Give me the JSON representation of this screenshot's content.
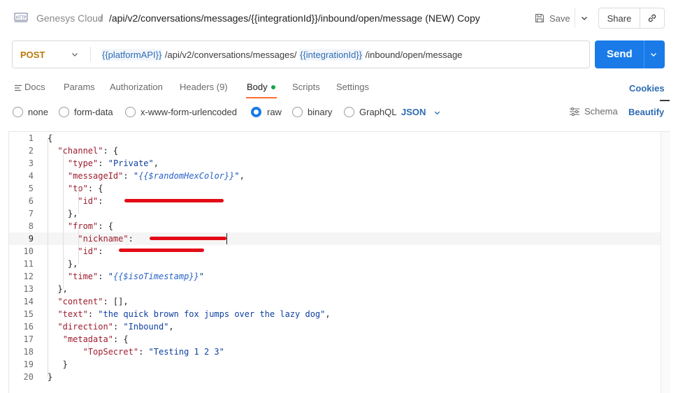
{
  "header": {
    "http_icon_label": "HTTP",
    "breadcrumb_root": "Genesys Cloud",
    "breadcrumb_sep": "/",
    "request_title": "/api/v2/conversations/messages/{{integrationId}}/inbound/open/message (NEW) Copy",
    "save_label": "Save",
    "share_label": "Share"
  },
  "request": {
    "method": "POST",
    "url_parts": [
      "{{platformAPI}}",
      " /api/v2/conversations/messages/ ",
      "{{integrationId}}",
      " /inbound/open/message"
    ],
    "send_label": "Send"
  },
  "tabs": [
    {
      "label": "Docs"
    },
    {
      "label": "Params"
    },
    {
      "label": "Authorization"
    },
    {
      "label": "Headers (9)"
    },
    {
      "label": "Body",
      "active": true
    },
    {
      "label": "Scripts"
    },
    {
      "label": "Settings"
    }
  ],
  "cookies_label": "Cookies",
  "body_types": {
    "options": [
      "none",
      "form-data",
      "x-www-form-urlencoded",
      "raw",
      "binary",
      "GraphQL"
    ],
    "selected": "raw",
    "format": "JSON",
    "schema_label": "Schema",
    "beautify_label": "Beautify"
  },
  "editor": {
    "current_line": 9,
    "lines": [
      {
        "n": "1",
        "tokens": [
          [
            "p",
            "{"
          ]
        ]
      },
      {
        "n": "2",
        "tokens": [
          [
            "p",
            "  "
          ],
          [
            "k",
            "\"channel\""
          ],
          [
            "p",
            ": {"
          ]
        ]
      },
      {
        "n": "3",
        "tokens": [
          [
            "p",
            "    "
          ],
          [
            "k",
            "\"type\""
          ],
          [
            "p",
            ": "
          ],
          [
            "s",
            "\"Private\""
          ],
          [
            "p",
            ","
          ]
        ]
      },
      {
        "n": "4",
        "tokens": [
          [
            "p",
            "    "
          ],
          [
            "k",
            "\"messageId\""
          ],
          [
            "p",
            ": "
          ],
          [
            "s",
            "\""
          ],
          [
            "tv",
            "{{$randomHexColor}}"
          ],
          [
            "s",
            "\""
          ],
          [
            "p",
            ","
          ]
        ]
      },
      {
        "n": "5",
        "tokens": [
          [
            "p",
            "    "
          ],
          [
            "k",
            "\"to\""
          ],
          [
            "p",
            ": {"
          ]
        ]
      },
      {
        "n": "6",
        "tokens": [
          [
            "p",
            "      "
          ],
          [
            "k",
            "\"id\""
          ],
          [
            "p",
            ": "
          ]
        ]
      },
      {
        "n": "7",
        "tokens": [
          [
            "p",
            "    },"
          ]
        ]
      },
      {
        "n": "8",
        "tokens": [
          [
            "p",
            "    "
          ],
          [
            "k",
            "\"from\""
          ],
          [
            "p",
            ": {"
          ]
        ]
      },
      {
        "n": "9",
        "tokens": [
          [
            "p",
            "      "
          ],
          [
            "k",
            "\"nickname\""
          ],
          [
            "p",
            ":"
          ]
        ]
      },
      {
        "n": "10",
        "tokens": [
          [
            "p",
            "      "
          ],
          [
            "k",
            "\"id\""
          ],
          [
            "p",
            ":"
          ]
        ]
      },
      {
        "n": "11",
        "tokens": [
          [
            "p",
            "    },"
          ]
        ]
      },
      {
        "n": "12",
        "tokens": [
          [
            "p",
            "    "
          ],
          [
            "k",
            "\"time\""
          ],
          [
            "p",
            ": "
          ],
          [
            "s",
            "\""
          ],
          [
            "tv",
            "{{$isoTimestamp}}"
          ],
          [
            "s",
            "\""
          ]
        ]
      },
      {
        "n": "13",
        "tokens": [
          [
            "p",
            "  },"
          ]
        ]
      },
      {
        "n": "14",
        "tokens": [
          [
            "p",
            "  "
          ],
          [
            "k",
            "\"content\""
          ],
          [
            "p",
            ": [],"
          ]
        ]
      },
      {
        "n": "15",
        "tokens": [
          [
            "p",
            "  "
          ],
          [
            "k",
            "\"text\""
          ],
          [
            "p",
            ": "
          ],
          [
            "s",
            "\"the quick brown fox jumps over the lazy dog\""
          ],
          [
            "p",
            ","
          ]
        ]
      },
      {
        "n": "16",
        "tokens": [
          [
            "p",
            "  "
          ],
          [
            "k",
            "\"direction\""
          ],
          [
            "p",
            ": "
          ],
          [
            "s",
            "\"Inbound\""
          ],
          [
            "p",
            ","
          ]
        ]
      },
      {
        "n": "17",
        "tokens": [
          [
            "p",
            "   "
          ],
          [
            "k",
            "\"metadata\""
          ],
          [
            "p",
            ": {"
          ]
        ]
      },
      {
        "n": "18",
        "tokens": [
          [
            "p",
            "       "
          ],
          [
            "k",
            "\"TopSecret\""
          ],
          [
            "p",
            ": "
          ],
          [
            "s",
            "\"Testing 1 2 3\""
          ]
        ]
      },
      {
        "n": "19",
        "tokens": [
          [
            "p",
            "   }"
          ]
        ]
      },
      {
        "n": "20",
        "tokens": [
          [
            "p",
            "}"
          ]
        ]
      }
    ]
  },
  "colors": {
    "accent": "#1a7be8",
    "method": "#b97a0b",
    "tab_underline": "#ff6c37",
    "body_dot": "#17a34a",
    "json_key": "#9c1c2e",
    "json_string": "#0d3fa0",
    "template_var": "#2a64c6",
    "redaction": "#e30b17"
  }
}
